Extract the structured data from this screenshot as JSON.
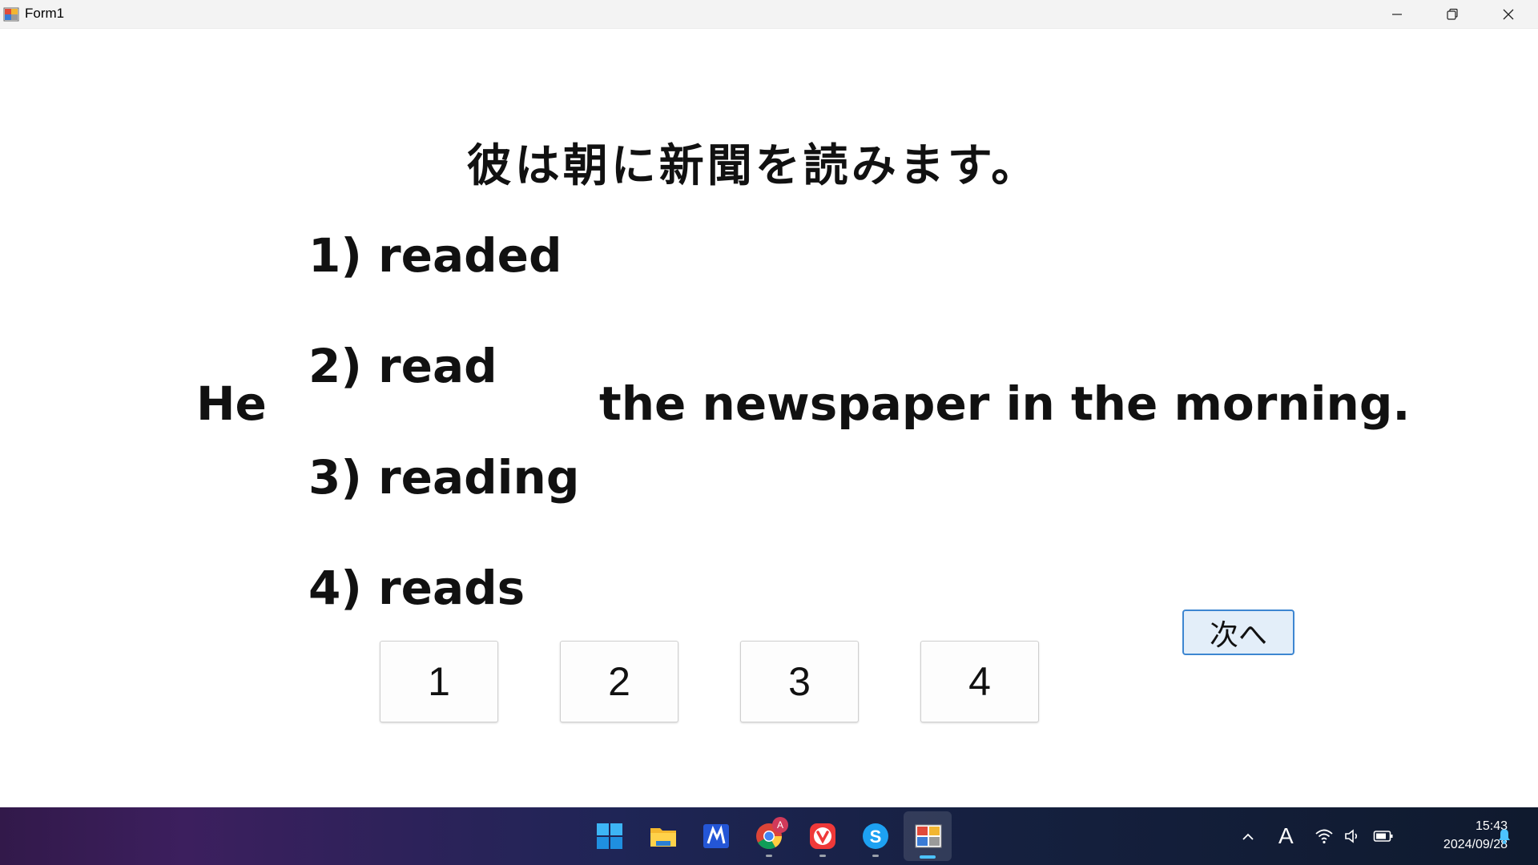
{
  "window": {
    "title": "Form1"
  },
  "quiz": {
    "question_jp": "彼は朝に新聞を読みます。",
    "sentence_subject": "He",
    "sentence_rest": "the newspaper in the morning.",
    "options": [
      {
        "label": "1) readed"
      },
      {
        "label": "2) read"
      },
      {
        "label": "3) reading"
      },
      {
        "label": "4) reads"
      }
    ],
    "answer_buttons": [
      "1",
      "2",
      "3",
      "4"
    ],
    "next_label": "次へ"
  },
  "taskbar": {
    "apps": [
      "windows-start",
      "file-explorer",
      "app-m",
      "chrome",
      "vivaldi",
      "skype",
      "form1-app"
    ],
    "chrome_badge": "A",
    "ime_indicator": "A",
    "time": "15:43",
    "date": "2024/09/28"
  },
  "colors": {
    "next_button_border": "#3d86d1",
    "next_button_bg": "#e3eef9",
    "taskbar_accent": "#4cc2ff"
  }
}
